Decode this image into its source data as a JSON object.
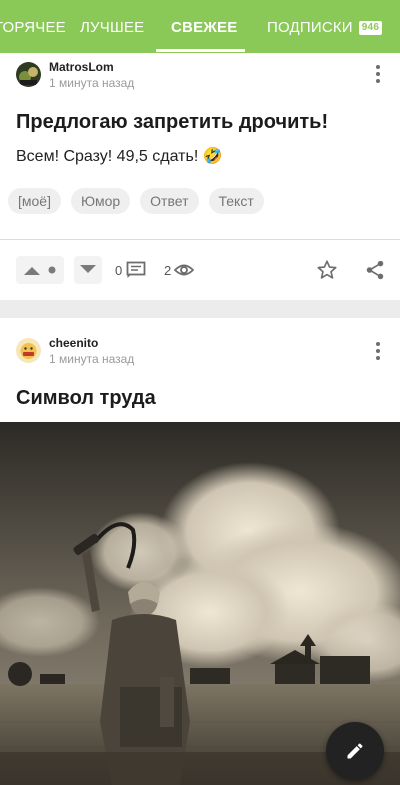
{
  "tabs": [
    {
      "label": "ГОРЯЧЕЕ"
    },
    {
      "label": "ЛУЧШЕЕ"
    },
    {
      "label": "СВЕЖЕЕ"
    },
    {
      "label": "ПОДПИСКИ",
      "badge": "946"
    }
  ],
  "active_tab": "СВЕЖЕЕ",
  "posts": [
    {
      "author": "MatrosLom",
      "time": "1 минута назад",
      "title": "Предлогаю запретить дрочить!",
      "text": "Всем! Сразу! 49,5 сдать! 🤣",
      "tags": [
        "[моё]",
        "Юмор",
        "Ответ",
        "Текст"
      ],
      "comments": "0",
      "views": "2"
    },
    {
      "author": "cheenito",
      "time": "1 минута назад",
      "title": "Символ труда"
    }
  ],
  "colors": {
    "accent": "#8ac858",
    "fab": "#222222"
  },
  "icons": [
    "more-vertical-icon",
    "upvote-icon",
    "downvote-icon",
    "comment-icon",
    "eye-icon",
    "star-icon",
    "share-icon",
    "pencil-icon"
  ]
}
